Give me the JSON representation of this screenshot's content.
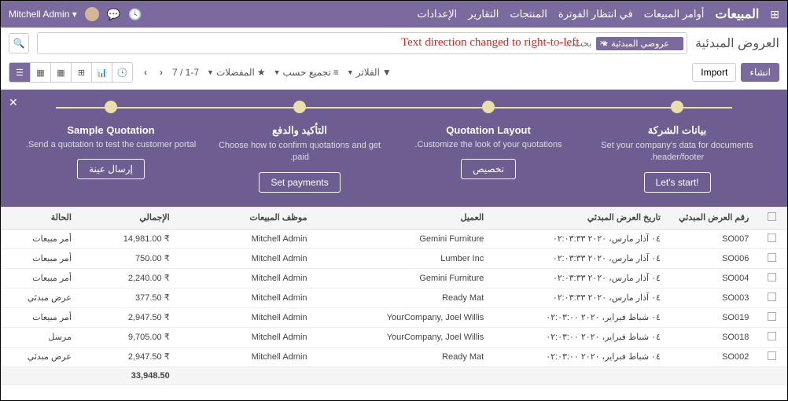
{
  "topnav": {
    "brand": "المبيعات",
    "menu": [
      "أوامر المبيعات",
      "في انتظار الفوترة",
      "المنتجات",
      "التقارير",
      "الإعدادات"
    ],
    "user": "Mitchell Admin"
  },
  "subhead": {
    "title": "العروض المبدئية",
    "facet": "عروضي المبدئية",
    "placeholder": "بحث..."
  },
  "toolbar": {
    "create": "انشاء",
    "import": "Import",
    "filters": "الفلاتر",
    "groupby": "تجميع حسب",
    "favorites": "المفضلات",
    "pager": "7 / 1-7"
  },
  "banner": {
    "steps": [
      {
        "title": "بيانات الشركة",
        "desc": "Set your company's data for documents header/footer.",
        "btn": "!Let's start"
      },
      {
        "title": "Quotation Layout",
        "desc": "Customize the look of your quotations.",
        "btn": "تخصيص"
      },
      {
        "title": "التأكيد والدفع",
        "desc": "Choose how to confirm quotations and get paid.",
        "btn": "Set payments"
      },
      {
        "title": "Sample Quotation",
        "desc": "Send a quotation to test the customer portal.",
        "btn": "إرسال عينة"
      }
    ]
  },
  "table": {
    "headers": {
      "num": "رقم العرض المبدئي",
      "date": "تاريخ العرض المبدئي",
      "cust": "العميل",
      "sales": "موظف المبيعات",
      "total": "الإجمالي",
      "status": "الحالة"
    },
    "rows": [
      {
        "num": "SO007",
        "date": "٠٤ آذار مارس، ٢٠٢٠ ٠٢:٠٣:٣٣",
        "cust": "Gemini Furniture",
        "sales": "Mitchell Admin",
        "total": "₹ 14,981.00",
        "status": "أمر مبيعات"
      },
      {
        "num": "SO006",
        "date": "٠٤ آذار مارس، ٢٠٢٠ ٠٢:٠٣:٣٣",
        "cust": "Lumber Inc",
        "sales": "Mitchell Admin",
        "total": "₹ 750.00",
        "status": "أمر مبيعات"
      },
      {
        "num": "SO004",
        "date": "٠٤ آذار مارس، ٢٠٢٠ ٠٢:٠٣:٣٣",
        "cust": "Gemini Furniture",
        "sales": "Mitchell Admin",
        "total": "₹ 2,240.00",
        "status": "أمر مبيعات"
      },
      {
        "num": "SO003",
        "date": "٠٤ آذار مارس، ٢٠٢٠ ٠٢:٠٣:٣٣",
        "cust": "Ready Mat",
        "sales": "Mitchell Admin",
        "total": "₹ 377.50",
        "status": "عرض مبدئي"
      },
      {
        "num": "SO019",
        "date": "٠٤ شباط فبراير، ٢٠٢٠ ٠٢:٠٣:٠٠",
        "cust": "YourCompany, Joel Willis",
        "sales": "Mitchell Admin",
        "total": "₹ 2,947.50",
        "status": "أمر مبيعات"
      },
      {
        "num": "SO018",
        "date": "٠٤ شباط فبراير، ٢٠٢٠ ٠٢:٠٣:٠٠",
        "cust": "YourCompany, Joel Willis",
        "sales": "Mitchell Admin",
        "total": "₹ 9,705.00",
        "status": "مرسل"
      },
      {
        "num": "SO002",
        "date": "٠٤ شباط فبراير، ٢٠٢٠ ٠٢:٠٣:٠٠",
        "cust": "Ready Mat",
        "sales": "Mitchell Admin",
        "total": "₹ 2,947.50",
        "status": "عرض مبدئي"
      }
    ],
    "footer_total": "33,948.50"
  },
  "annotation": "Text direction changed to right-to-left"
}
